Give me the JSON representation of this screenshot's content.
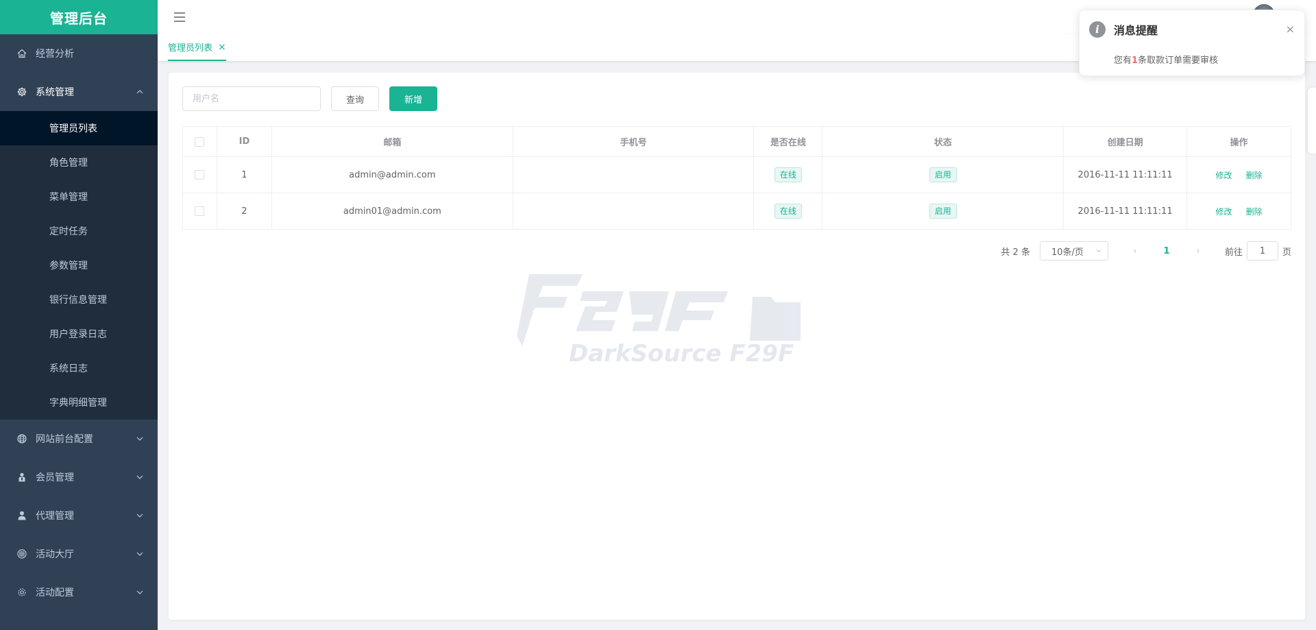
{
  "app": {
    "title": "管理后台"
  },
  "sidebar": {
    "items": [
      {
        "label": "经营分析",
        "icon": "home-icon"
      },
      {
        "label": "系统管理",
        "icon": "gear-icon",
        "expanded": true,
        "children": [
          {
            "label": "管理员列表",
            "active": true
          },
          {
            "label": "角色管理"
          },
          {
            "label": "菜单管理"
          },
          {
            "label": "定时任务"
          },
          {
            "label": "参数管理"
          },
          {
            "label": "银行信息管理"
          },
          {
            "label": "用户登录日志"
          },
          {
            "label": "系统日志"
          },
          {
            "label": "字典明细管理"
          }
        ]
      },
      {
        "label": "网站前台配置",
        "icon": "globe-icon"
      },
      {
        "label": "会员管理",
        "icon": "member-icon"
      },
      {
        "label": "代理管理",
        "icon": "user-icon"
      },
      {
        "label": "活动大厅",
        "icon": "activity-icon"
      },
      {
        "label": "活动配置",
        "icon": "settings-icon"
      }
    ]
  },
  "tags": [
    {
      "label": "管理员列表",
      "close": "×"
    }
  ],
  "search": {
    "placeholder": "用户名",
    "value": ""
  },
  "buttons": {
    "query": "查询",
    "add": "新增"
  },
  "table": {
    "headers": {
      "id": "ID",
      "email": "邮箱",
      "phone": "手机号",
      "online": "是否在线",
      "status": "状态",
      "created": "创建日期",
      "actions": "操作"
    },
    "rows": [
      {
        "id": "1",
        "email": "admin@admin.com",
        "phone": "",
        "online": "在线",
        "status": "启用",
        "created": "2016-11-11 11:11:11",
        "edit": "修改",
        "delete": "删除"
      },
      {
        "id": "2",
        "email": "admin01@admin.com",
        "phone": "",
        "online": "在线",
        "status": "启用",
        "created": "2016-11-11 11:11:11",
        "edit": "修改",
        "delete": "删除"
      }
    ]
  },
  "pagination": {
    "total": "共 2 条",
    "page_size": "10条/页",
    "prev": "‹",
    "next": "›",
    "current": "1",
    "jump_label": "前往",
    "jump_value": "1",
    "jump_suffix": "页"
  },
  "notification": {
    "title": "消息提醒",
    "close": "×",
    "message_prefix": "您有",
    "message_count": "1",
    "message_suffix": "条取款订单需要审核"
  },
  "colors": {
    "accent": "#1ab394",
    "sidebar_bg": "#304156",
    "submenu_bg": "#1f2d3d",
    "sub_active_bg": "#001528"
  }
}
